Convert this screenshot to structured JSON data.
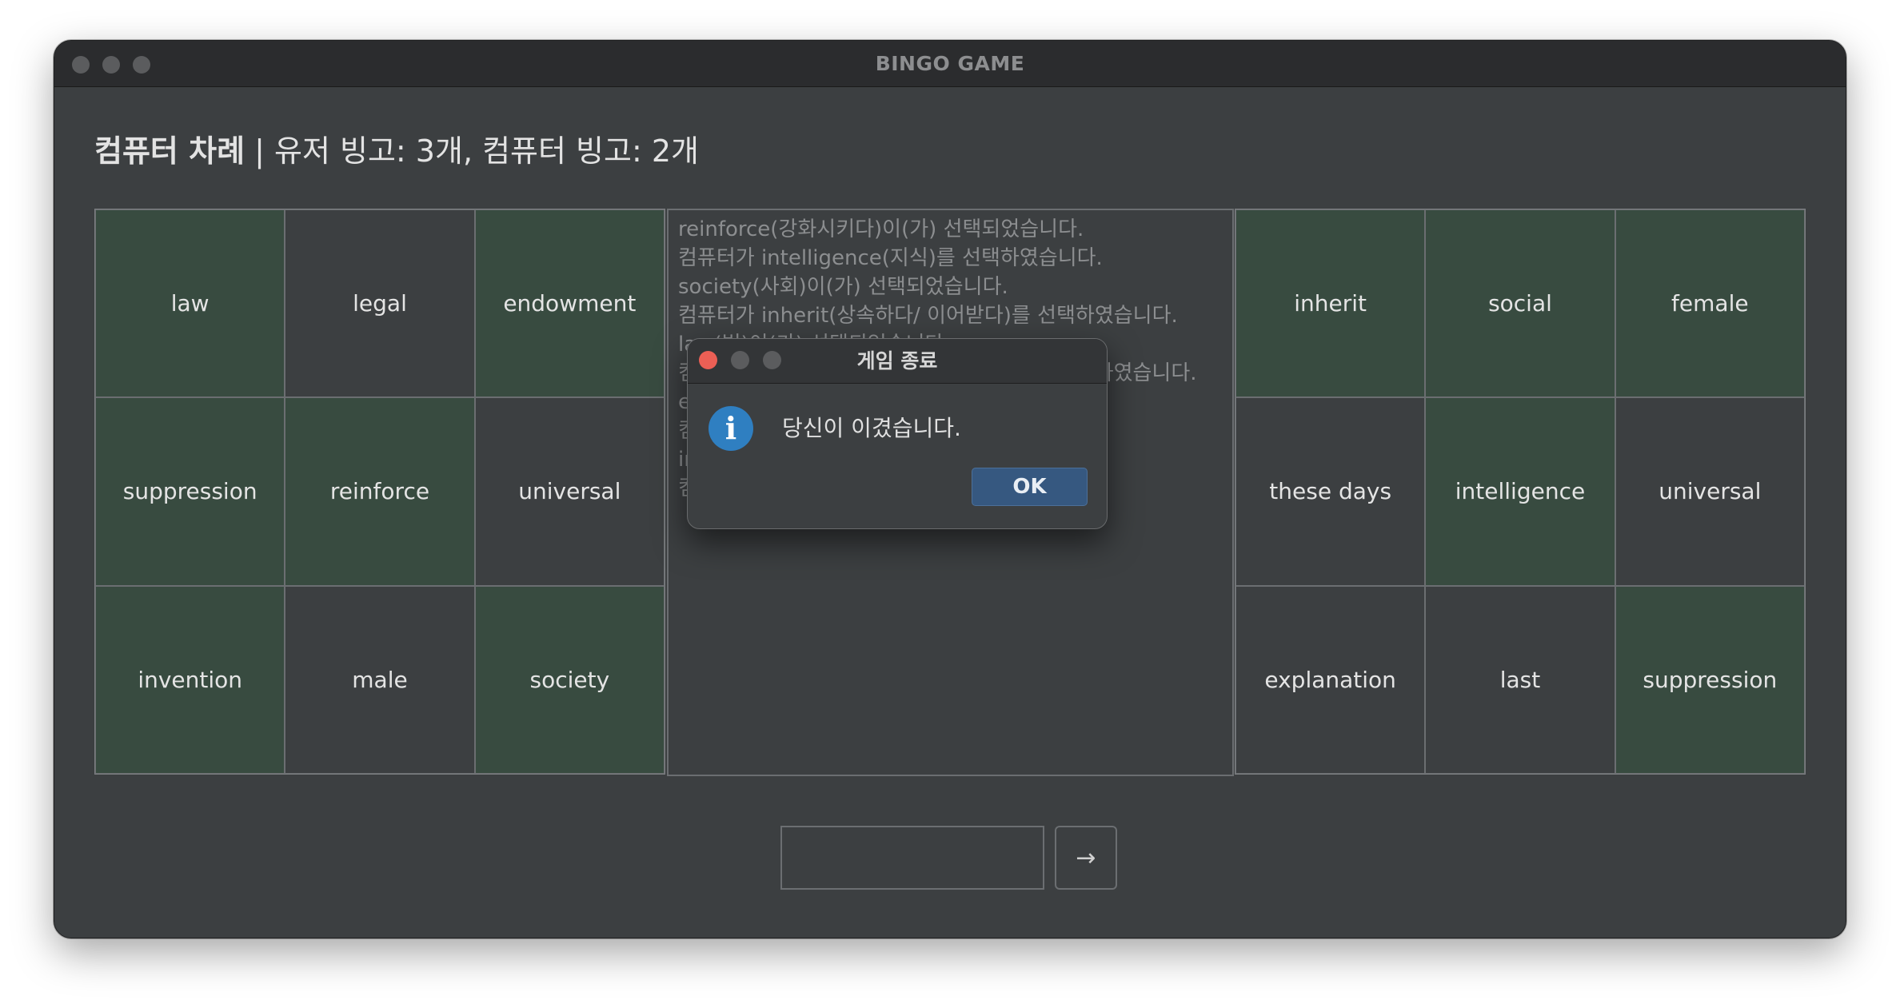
{
  "window": {
    "title": "BINGO GAME"
  },
  "status": {
    "turn": "컴퓨터 차례",
    "separator": " | ",
    "scores": "유저 빙고: 3개, 컴퓨터 빙고: 2개"
  },
  "user_board": [
    {
      "word": "law",
      "marked": true
    },
    {
      "word": "legal",
      "marked": false
    },
    {
      "word": "endowment",
      "marked": true
    },
    {
      "word": "suppression",
      "marked": true
    },
    {
      "word": "reinforce",
      "marked": true
    },
    {
      "word": "universal",
      "marked": false
    },
    {
      "word": "invention",
      "marked": true
    },
    {
      "word": "male",
      "marked": false
    },
    {
      "word": "society",
      "marked": true
    }
  ],
  "computer_board": [
    {
      "word": "inherit",
      "marked": true
    },
    {
      "word": "social",
      "marked": true
    },
    {
      "word": "female",
      "marked": true
    },
    {
      "word": "these days",
      "marked": false
    },
    {
      "word": "intelligence",
      "marked": true
    },
    {
      "word": "universal",
      "marked": false
    },
    {
      "word": "explanation",
      "marked": false
    },
    {
      "word": "last",
      "marked": false
    },
    {
      "word": "suppression",
      "marked": true
    }
  ],
  "log": [
    "reinforce(강화시키다)이(가) 선택되었습니다.",
    "컴퓨터가 intelligence(지식)를 선택하였습니다.",
    "society(사회)이(가) 선택되었습니다.",
    "컴퓨터가 inherit(상속하다/ 이어받다)를 선택하였습니다.",
    "law(법)이(가) 선택되었습니다.",
    "컴퓨터가 suppression(저하/ 의기소침)를 선택하였습니다.",
    "endow",
    "컴퓨터",
    "invent",
    "컴퓨터"
  ],
  "input": {
    "value": ""
  },
  "submit": {
    "label": "→"
  },
  "dialog": {
    "title": "게임 종료",
    "message": "당신이 이겼습니다.",
    "ok_label": "OK",
    "icon": "info-icon"
  },
  "colors": {
    "window_bg": "#3c3f41",
    "marked_cell": "#384b40",
    "close_red": "#ec5f55",
    "info_blue": "#2f7fc1",
    "ok_button": "#365880"
  }
}
